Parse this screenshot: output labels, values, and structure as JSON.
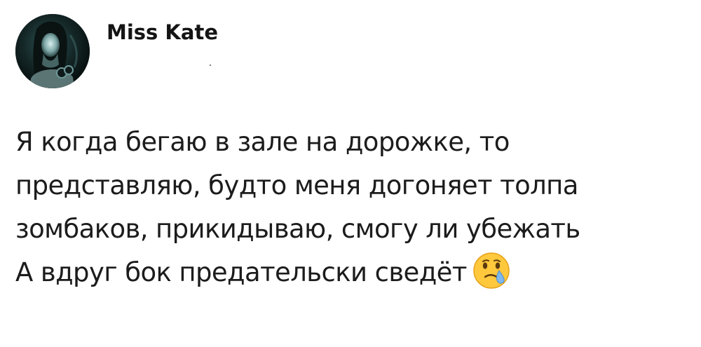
{
  "post": {
    "author": {
      "name": "Miss Kate",
      "avatar_icon": "user-avatar-photo"
    },
    "body_lines": [
      "Я когда бегаю в зале на дорожке, то",
      "представляю, будто меня догоняет толпа",
      "зомбаков, прикидываю, смогу ли убежать",
      "А вдруг бок предательски сведёт"
    ],
    "trailing_emoji": "face-holding-back-tears-icon"
  },
  "colors": {
    "text": "#1c1c1c",
    "background": "#ffffff",
    "emoji_face": "#ffc83d",
    "emoji_tear": "#7fb8ec"
  }
}
